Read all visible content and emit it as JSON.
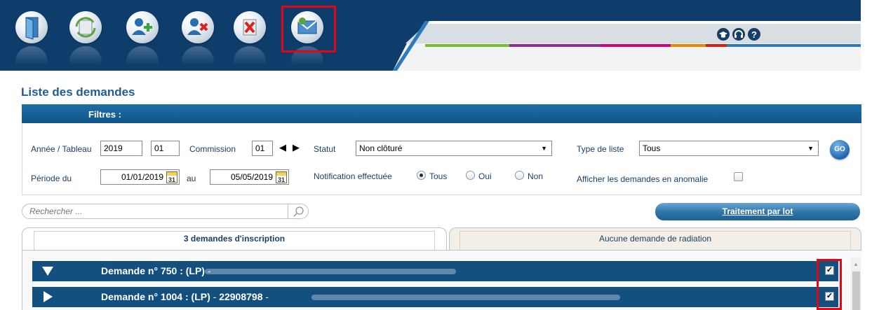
{
  "toolbar": {
    "buttons": [
      {
        "icon": "exit-door-icon"
      },
      {
        "icon": "refresh-icon"
      },
      {
        "icon": "add-user-icon"
      },
      {
        "icon": "remove-user-icon"
      },
      {
        "icon": "delete-document-icon"
      },
      {
        "icon": "send-mail-icon",
        "highlighted": true
      }
    ],
    "help_icons": [
      "graduation-cap-icon",
      "support-headset-icon",
      "help-question-icon"
    ]
  },
  "colors": {
    "header_dark": "#0e3d6b",
    "accent_blue": "#1f6ea6",
    "row_bg": "#14507f",
    "highlight_red": "#e30613",
    "stripe_colors": [
      "#7dbb2c",
      "#8e2c8f",
      "#d6007a",
      "#e88b00",
      "#d91e18",
      "#2b7bbd"
    ]
  },
  "page": {
    "title": "Liste des demandes"
  },
  "filters": {
    "title": "Filtres :",
    "year_label": "Année / Tableau",
    "year_value": "2019",
    "tableau_value": "01",
    "commission_label": "Commission",
    "commission_value": "01",
    "status_label": "Statut",
    "status_value": "Non clôturé",
    "list_type_label": "Type de liste",
    "list_type_value": "Tous",
    "period_label": "Période du",
    "period_from": "01/01/2019",
    "period_to_label": "au",
    "period_to": "05/05/2019",
    "calendar_day": "31",
    "notification_label": "Notification effectuée",
    "notification_options": [
      "Tous",
      "Oui",
      "Non"
    ],
    "notification_selected": "Tous",
    "anomaly_label": "Afficher les demandes en anomalie",
    "go_label": "GO"
  },
  "search": {
    "placeholder": "Rechercher ..."
  },
  "batch_button": {
    "label": "Traitement par lot"
  },
  "tabs": [
    {
      "label": "3 demandes d'inscription",
      "active": true
    },
    {
      "label": "Aucune demande de radiation",
      "active": false
    }
  ],
  "requests": [
    {
      "title": "Demande n° 750 : (LP)",
      "suffix": "",
      "expanded": true,
      "checked": true
    },
    {
      "title": "Demande n° 1004 : (LP)",
      "suffix": "22908798",
      "expanded": false,
      "checked": true
    }
  ]
}
